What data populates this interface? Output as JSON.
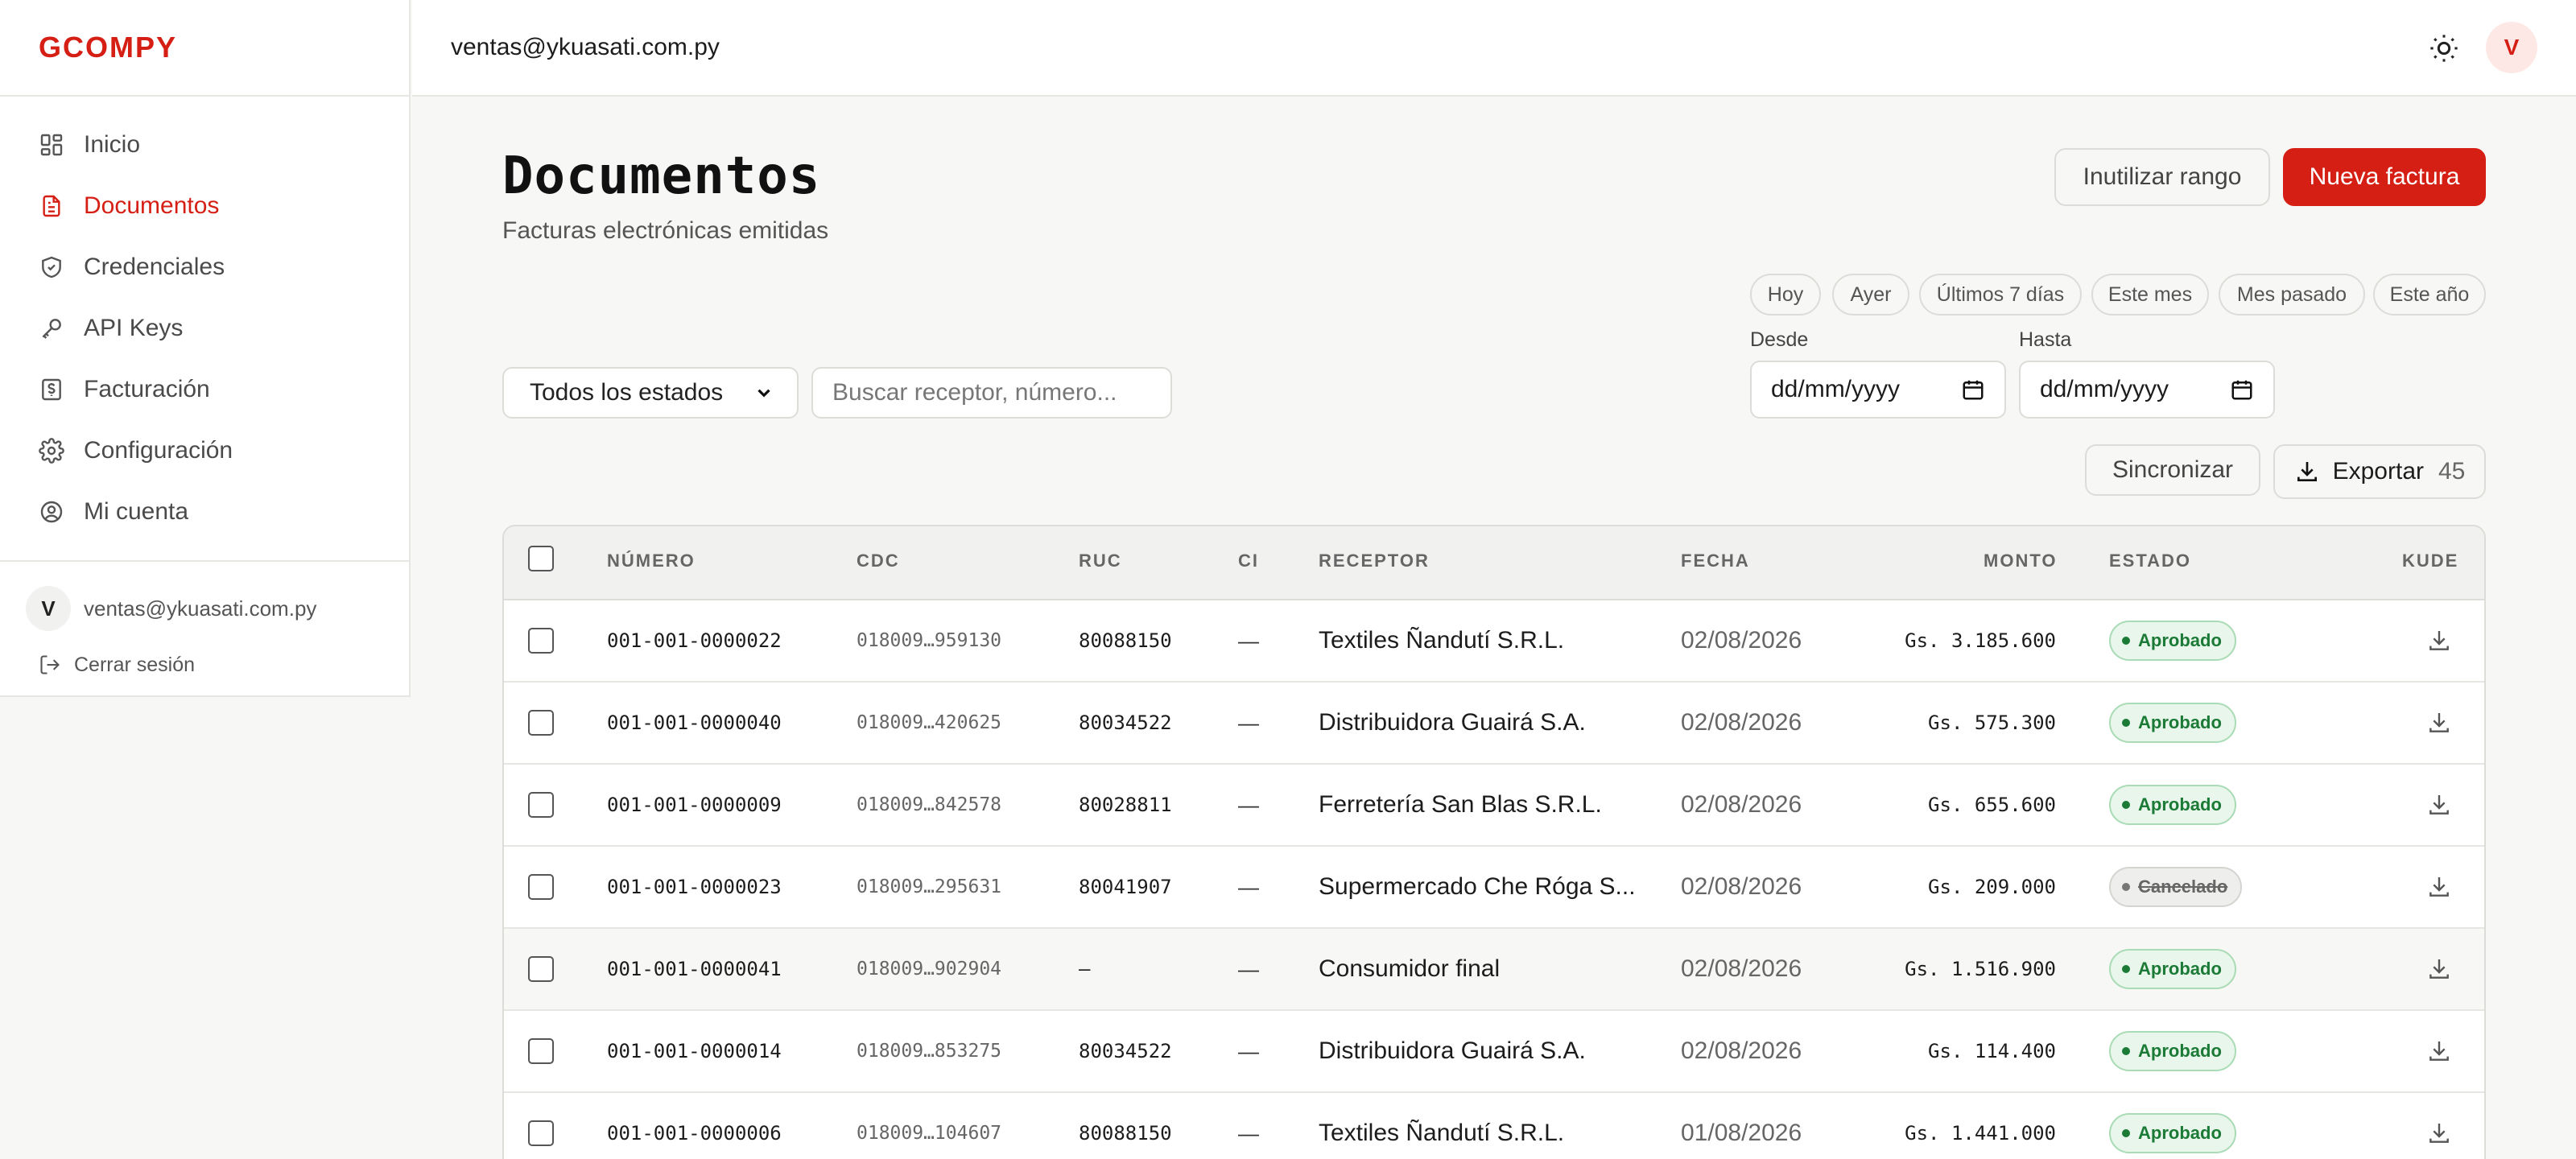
{
  "brand": {
    "logo": "GCOMPY"
  },
  "sidebar": {
    "items": [
      {
        "label": "Inicio",
        "icon": "dashboard-icon",
        "active": false
      },
      {
        "label": "Documentos",
        "icon": "document-icon",
        "active": true
      },
      {
        "label": "Credenciales",
        "icon": "shield-icon",
        "active": false
      },
      {
        "label": "API Keys",
        "icon": "key-icon",
        "active": false
      },
      {
        "label": "Facturación",
        "icon": "billing-icon",
        "active": false
      },
      {
        "label": "Configuración",
        "icon": "gear-icon",
        "active": false
      },
      {
        "label": "Mi cuenta",
        "icon": "user-circle-icon",
        "active": false
      }
    ],
    "user": {
      "initial": "V",
      "email": "ventas@ykuasati.com.py"
    },
    "logout_label": "Cerrar sesión"
  },
  "header": {
    "email": "ventas@ykuasati.com.py",
    "avatar_initial": "V"
  },
  "page": {
    "title": "Documentos",
    "subtitle": "Facturas electrónicas emitidas",
    "inutilizar_label": "Inutilizar rango",
    "nueva_factura_label": "Nueva factura"
  },
  "filters": {
    "quick_ranges": [
      "Hoy",
      "Ayer",
      "Últimos 7 días",
      "Este mes",
      "Mes pasado",
      "Este año"
    ],
    "desde_label": "Desde",
    "hasta_label": "Hasta",
    "desde_value": "dd/mm/yyyy",
    "hasta_value": "dd/mm/yyyy",
    "estado_value": "Todos los estados",
    "search_placeholder": "Buscar receptor, número..."
  },
  "actions": {
    "sync_label": "Sincronizar",
    "export_label": "Exportar",
    "export_count": "45"
  },
  "table": {
    "columns": [
      "NÚMERO",
      "CDC",
      "RUC",
      "CI",
      "RECEPTOR",
      "FECHA",
      "MONTO",
      "ESTADO",
      "KUDE"
    ],
    "rows": [
      {
        "numero": "001-001-0000022",
        "cdc": "018009…959130",
        "ruc": "80088150",
        "ci": "—",
        "receptor": "Textiles Ñandutí S.R.L.",
        "fecha": "02/08/2026",
        "monto": "Gs. 3.185.600",
        "estado": "Aprobado"
      },
      {
        "numero": "001-001-0000040",
        "cdc": "018009…420625",
        "ruc": "80034522",
        "ci": "—",
        "receptor": "Distribuidora Guairá S.A.",
        "fecha": "02/08/2026",
        "monto": "Gs. 575.300",
        "estado": "Aprobado"
      },
      {
        "numero": "001-001-0000009",
        "cdc": "018009…842578",
        "ruc": "80028811",
        "ci": "—",
        "receptor": "Ferretería San Blas S.R.L.",
        "fecha": "02/08/2026",
        "monto": "Gs. 655.600",
        "estado": "Aprobado"
      },
      {
        "numero": "001-001-0000023",
        "cdc": "018009…295631",
        "ruc": "80041907",
        "ci": "—",
        "receptor": "Supermercado Che Róga S...",
        "fecha": "02/08/2026",
        "monto": "Gs. 209.000",
        "estado": "Cancelado"
      },
      {
        "numero": "001-001-0000041",
        "cdc": "018009…902904",
        "ruc": "—",
        "ci": "—",
        "receptor": "Consumidor final",
        "fecha": "02/08/2026",
        "monto": "Gs. 1.516.900",
        "estado": "Aprobado"
      },
      {
        "numero": "001-001-0000014",
        "cdc": "018009…853275",
        "ruc": "80034522",
        "ci": "—",
        "receptor": "Distribuidora Guairá S.A.",
        "fecha": "02/08/2026",
        "monto": "Gs. 114.400",
        "estado": "Aprobado"
      },
      {
        "numero": "001-001-0000006",
        "cdc": "018009…104607",
        "ruc": "80088150",
        "ci": "—",
        "receptor": "Textiles Ñandutí S.R.L.",
        "fecha": "01/08/2026",
        "monto": "Gs. 1.441.000",
        "estado": "Aprobado"
      }
    ]
  },
  "colors": {
    "accent": "#d61f14",
    "approved": "#1b7a35",
    "cancelled": "#666666"
  }
}
